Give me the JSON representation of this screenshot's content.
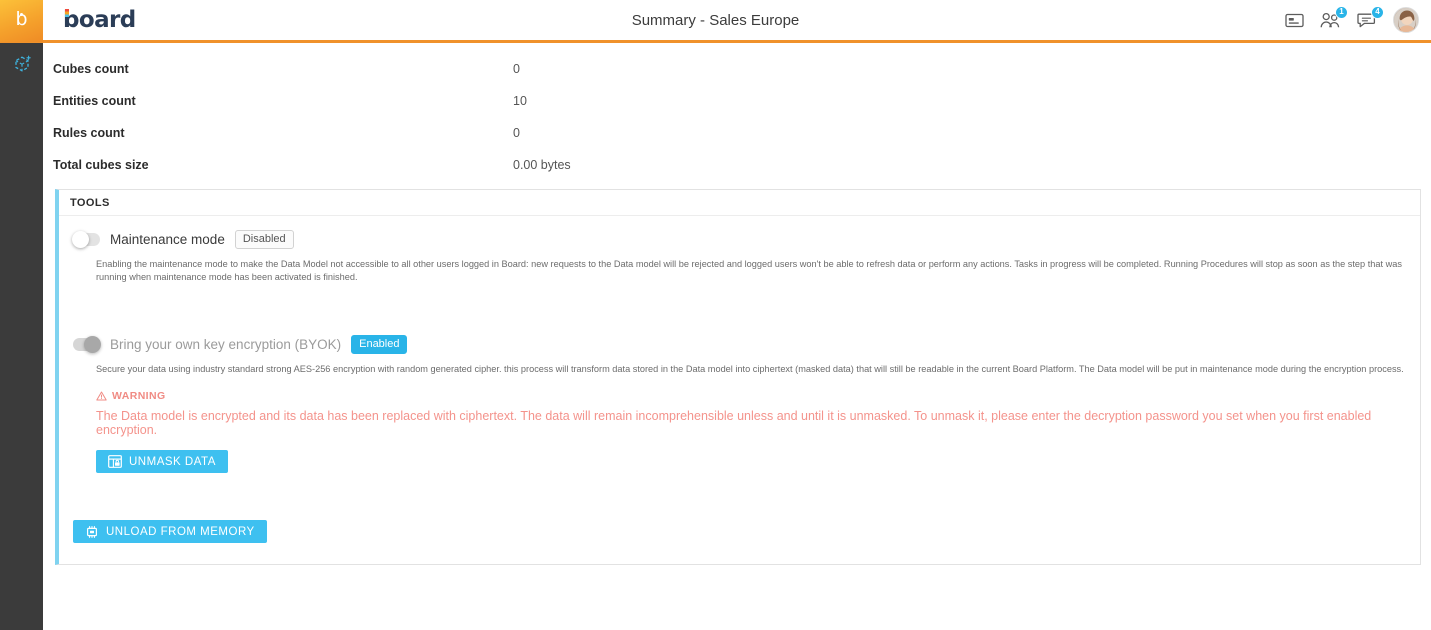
{
  "header": {
    "title": "Summary - Sales Europe",
    "brand": "board",
    "logo_mark": "b",
    "icons": [
      {
        "name": "card-icon",
        "label": "card"
      },
      {
        "name": "users-icon",
        "label": "users",
        "badge": "1"
      },
      {
        "name": "chat-icon",
        "label": "chat",
        "badge": "4"
      }
    ],
    "avatar_label": "user-avatar"
  },
  "sidebar": {
    "items": [
      {
        "name": "add-cube-icon",
        "label": "Add cube"
      }
    ]
  },
  "summary": {
    "rows": [
      {
        "label": "Cubes count",
        "value": "0"
      },
      {
        "label": "Entities count",
        "value": "10"
      },
      {
        "label": "Rules count",
        "value": "0"
      },
      {
        "label": "Total cubes size",
        "value": "0.00 bytes"
      }
    ]
  },
  "tools": {
    "panel_title": "TOOLS",
    "maintenance": {
      "label": "Maintenance mode",
      "status": "Disabled",
      "enabled": false,
      "description": "Enabling the maintenance mode to make the Data Model not accessible to all other users logged in Board: new requests to the Data model will be rejected and logged users won't be able to refresh data or perform any actions. Tasks in progress will be completed. Running Procedures will stop as soon as the step that was running when maintenance mode has been activated is finished."
    },
    "byok": {
      "label": "Bring your own key encryption (BYOK)",
      "status": "Enabled",
      "enabled": true,
      "description": "Secure your data using industry standard strong AES-256 encryption with random generated cipher. this process will transform data stored in the Data model into ciphertext (masked data) that will still be readable in the current Board Platform. The Data model will be put in maintenance mode during the encryption process.",
      "warning_title": "WARNING",
      "warning_text": "The Data model is encrypted and its data has been replaced with ciphertext. The data will remain incomprehensible unless and until it is unmasked. To unmask it, please enter the decryption password you set when you first enabled encryption.",
      "unmask_button": "UNMASK DATA"
    },
    "unload_button": "UNLOAD FROM MEMORY"
  },
  "colors": {
    "accent_orange": "#f0922b",
    "accent_cyan": "#29b4e8",
    "button_blue": "#3ec0f0",
    "warning_red": "#f4938c",
    "panel_bar": "#7fd3f0",
    "rail_bg": "#3b3b3b"
  }
}
